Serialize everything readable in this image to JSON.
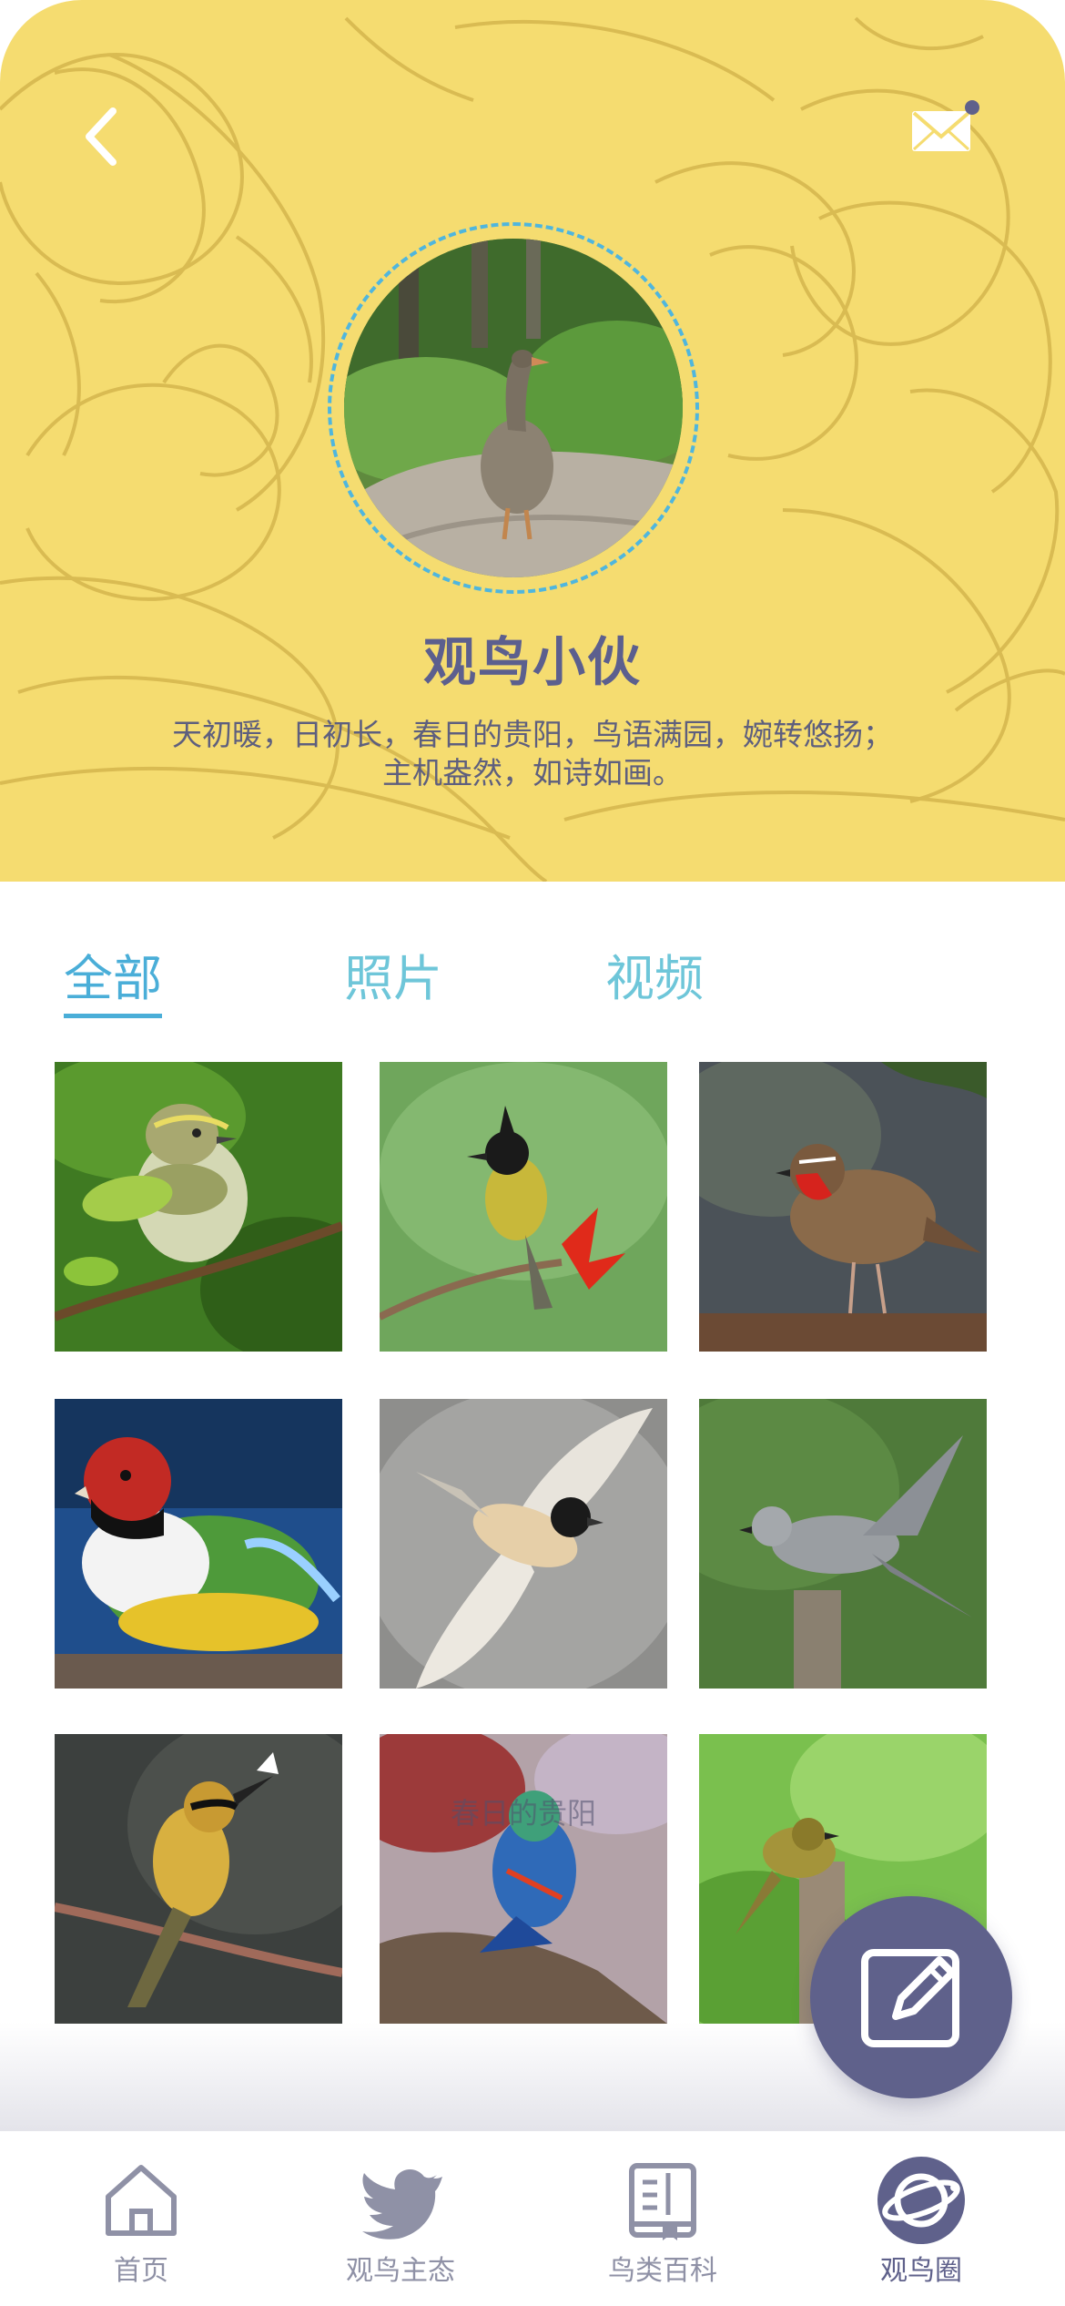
{
  "header": {
    "back_icon": "chevron-left-icon",
    "mail_icon": "mail-icon",
    "username": "观鸟小伙",
    "bio": "天初暖，日初长，春日的贵阳，鸟语满园，婉转悠扬；主机盎然，如诗如画。"
  },
  "tabs": [
    {
      "label": "全部",
      "active": true
    },
    {
      "label": "照片",
      "active": false
    },
    {
      "label": "视频",
      "active": false
    }
  ],
  "gallery": {
    "caption_overlay": "春日的贵阳"
  },
  "fab": {
    "icon": "edit-icon"
  },
  "bottom_nav": [
    {
      "label": "首页",
      "icon": "home-icon",
      "active": false
    },
    {
      "label": "观鸟主态",
      "icon": "bird-icon",
      "active": false
    },
    {
      "label": "鸟类百科",
      "icon": "book-icon",
      "active": false
    },
    {
      "label": "观鸟圈",
      "icon": "planet-icon",
      "active": true
    }
  ],
  "colors": {
    "header_bg": "#f5dc70",
    "accent": "#5f618b",
    "tab_active": "#4aaed8",
    "tab_inactive": "#6ec6d9"
  }
}
